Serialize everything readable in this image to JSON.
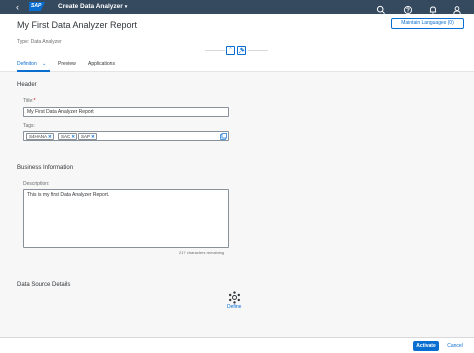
{
  "shell": {
    "back_icon": "chevron-left-icon",
    "logo_text": "SAP",
    "title": "Create Data Analyzer",
    "title_caret": "▾",
    "icons": [
      "search-icon",
      "help-icon",
      "notification-icon",
      "user-icon"
    ]
  },
  "header": {
    "title": "My First Data Analyzer Report",
    "maintain_button": "Maintain Languages (0)",
    "type": "Type: Data Analyzer"
  },
  "tabs": [
    {
      "label": "Definiton",
      "active": true,
      "dropdown": "⌄"
    },
    {
      "label": "Preview"
    },
    {
      "label": "Applications"
    }
  ],
  "sections": {
    "header": {
      "title": "Header",
      "title_label": "Title:",
      "required_marker": "*",
      "title_value": "My First Data Analyzer Report",
      "tags_label": "Tags:",
      "tags": [
        "S4HANA",
        "SAC",
        "SAP"
      ]
    },
    "business": {
      "title": "Business Information",
      "description_label": "Description:",
      "description_value": "This is my first Data Analyzer Report.",
      "counter": "217 characters remaining"
    },
    "datasource": {
      "title": "Data Source Details",
      "define_label": "Define",
      "define_icon": "cube-network-icon"
    }
  },
  "footer": {
    "activate": "Activate",
    "cancel": "Cancel"
  }
}
